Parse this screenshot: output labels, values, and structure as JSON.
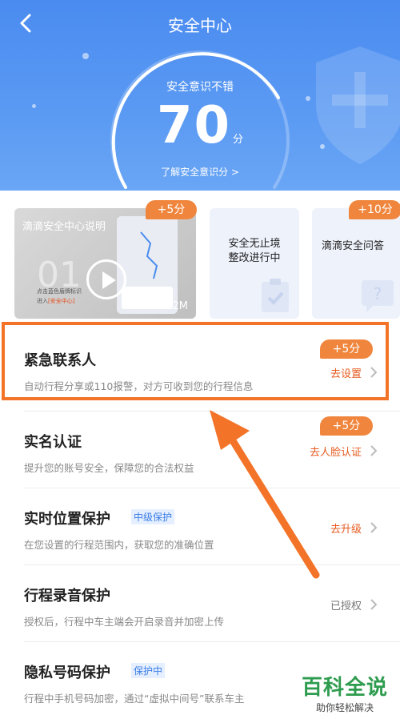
{
  "header": {
    "title": "安全中心",
    "score_label": "安全意识不错",
    "score": "70",
    "score_unit": "分",
    "learn_link": "了解安全意识分 >"
  },
  "cards": [
    {
      "title": "滴滴安全中心说明",
      "badge": "+5分",
      "duration": "2M",
      "big_number": "01",
      "text_line1": "点击蓝色盾牌标识",
      "text_line2_pre": "进入",
      "text_line2_red": "[安全中心]"
    },
    {
      "title_line1": "安全无止境",
      "title_line2": "整改进行中"
    },
    {
      "title": "滴滴安全问答",
      "badge": "+10分"
    }
  ],
  "list": [
    {
      "name": "紧急联系人",
      "desc": "自动行程分享或110报警，对方可收到您的行程信息",
      "action": "去设置",
      "badge": "+5分"
    },
    {
      "name": "实名认证",
      "desc": "提升您的账号安全，保障您的合法权益",
      "action": "去人脸认证",
      "badge": "+5分"
    },
    {
      "name": "实时位置保护",
      "tag": "中级保护",
      "desc": "在您设置的行程范围内，获取您的准确位置",
      "action": "去升级"
    },
    {
      "name": "行程录音保护",
      "desc": "授权后，行程中车主端会开启录音并加密上传",
      "action": "已授权"
    },
    {
      "name": "隐私号码保护",
      "tag": "保护中",
      "desc": "行程中手机号码加密，通过“虚拟中间号”联系车主"
    }
  ],
  "watermark": {
    "big": "百科全说",
    "small": "助你轻松解决"
  },
  "colors": {
    "header_blue": "#4a8bf0",
    "accent_orange": "#f0863d",
    "action_orange": "#e65a1f",
    "highlight": "#f37328"
  }
}
